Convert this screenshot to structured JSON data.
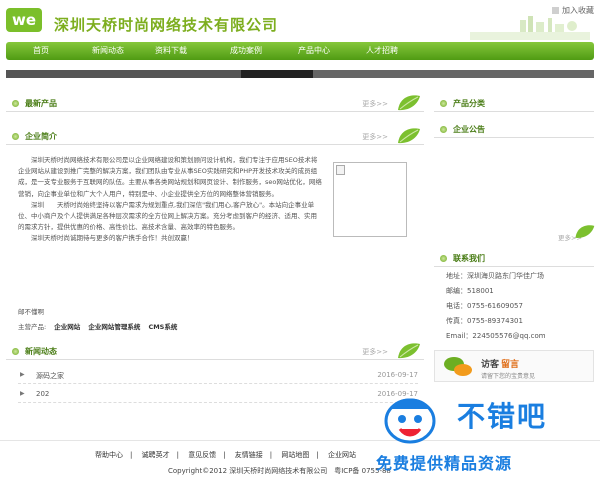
{
  "header": {
    "logo_text": "we",
    "company_name": "深圳天桥时尚网络技术有限公司",
    "favorite_label": "加入收藏"
  },
  "nav": {
    "items": [
      {
        "label": "首页"
      },
      {
        "label": "新闻动态"
      },
      {
        "label": "资料下载"
      },
      {
        "label": "成功案例"
      },
      {
        "label": "产品中心"
      },
      {
        "label": "人才招聘"
      }
    ]
  },
  "main": {
    "latest_products": {
      "title": "最新产品",
      "more": "更多>>"
    },
    "company_intro": {
      "title": "企业简介",
      "more": "更多>>",
      "paragraphs": [
        "深圳天桥时尚网络技术有限公司是以企业网络建设和策划顾问设计机构，我们专注于应用SEO技术将企业网站从建设到推广完整的解决方案，我们团队由专业从事SEO实践研究和PHP开发技术攻关的成员组成，是一支专业服务于互联网的队伍。主要从事各类网站规划和网页设计、制作服务，seo网站优化，网络营销，向企事业单位和广大个人用户，特别是中、小企业提供全方位的网络整体营销服务。",
        "深圳　　天桥时尚始终坚持以客户需求为规划重点,我们深信\"我们用心,客户放心\"。本站向企事业单位、中小商户及个人提供满足各种层次需求的全方位网上解决方案。充分考虑到客户的经济、适用、实用的需求方针，提供优惠的价格、高性价比、高技术含量、高效率的特色服务。",
        "深圳天桥时尚诚期待与更多的客户携手合作！共创双赢！"
      ],
      "email_label": "邮不懂啊",
      "main_products_label": "主营产品:",
      "main_products": [
        "企业网站",
        "企业网站管理系统",
        "CMS系统"
      ]
    },
    "news": {
      "title": "新闻动态",
      "more": "更多>>",
      "items": [
        {
          "title": "源码之家",
          "date": "2016-09-17"
        },
        {
          "title": "202",
          "date": "2016-09-17"
        }
      ]
    }
  },
  "sidebar": {
    "product_category": {
      "title": "产品分类"
    },
    "announcement": {
      "title": "企业公告",
      "more": "更多>>"
    },
    "contact": {
      "title": "联系我们",
      "address": "地址：深圳海贝路东门华佳广场",
      "postcode": "邮编：518001",
      "phone": "电话：0755-61609057",
      "fax": "传真：0755-89374301",
      "email": "Email：224505576@qq.com"
    },
    "guestbook": {
      "title_a": "访客",
      "title_b": "留言",
      "subtitle": "请留下您的宝贵意见"
    }
  },
  "footer": {
    "links": [
      "帮助中心",
      "诚聘英才",
      "意见反馈",
      "友情链接",
      "网站地图",
      "企业网站"
    ],
    "copyright": "Copyright©2012 深圳天桥时尚网络技术有限公司　粤ICP备 0755-88"
  },
  "watermark": {
    "big": "不错吧",
    "sub": "免费提供精品资源"
  },
  "colors": {
    "accent": "#6cae22",
    "nav_dark": "#4f9b13",
    "watermark": "#1a7ee0"
  }
}
